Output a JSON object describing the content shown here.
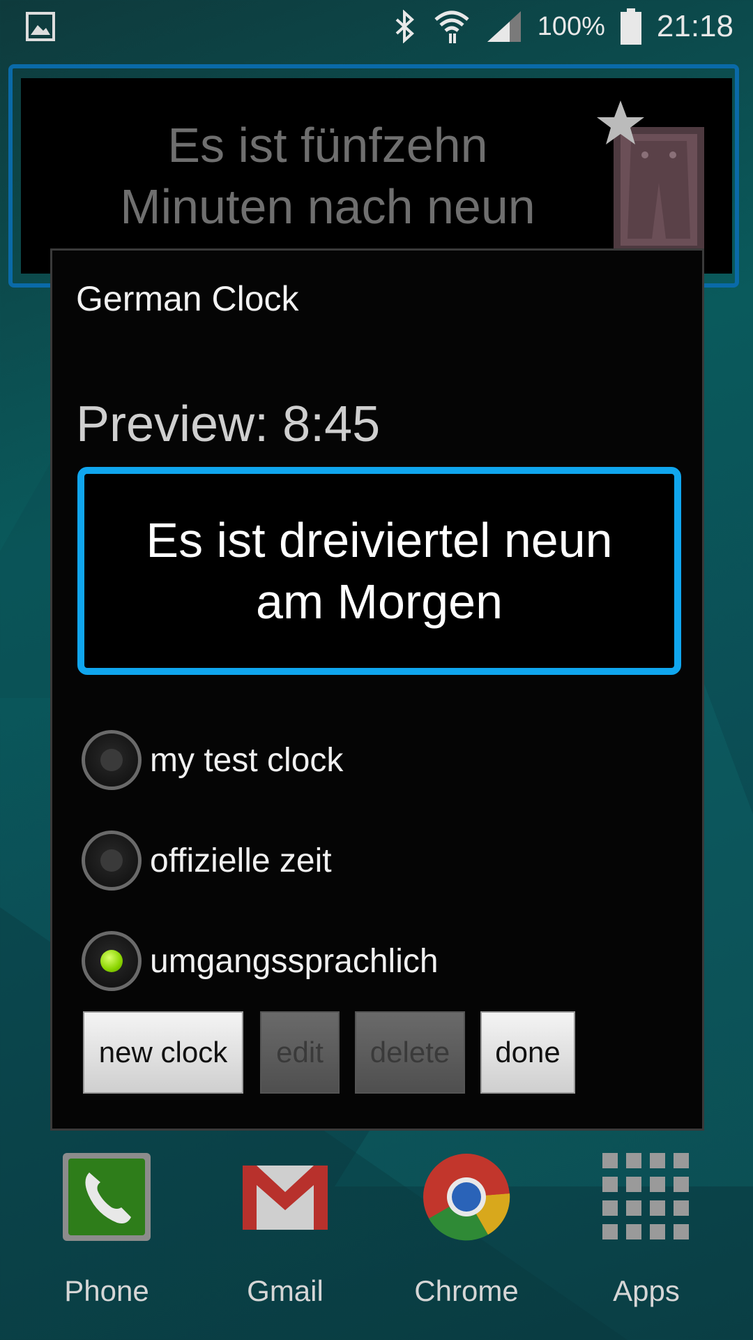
{
  "status_bar": {
    "battery_percent": "100%",
    "time": "21:18"
  },
  "widget": {
    "text": "Es ist fünfzehn Minuten nach neun Uhr"
  },
  "dialog": {
    "title": "German Clock",
    "preview_label": "Preview: 8:45",
    "preview_text": "Es ist dreiviertel neun am Morgen",
    "options": [
      {
        "label": "my test clock",
        "selected": false
      },
      {
        "label": "offizielle zeit",
        "selected": false
      },
      {
        "label": "umgangssprachlich",
        "selected": true
      }
    ],
    "buttons": {
      "new_clock": "new clock",
      "edit": "edit",
      "delete": "delete",
      "done": "done"
    }
  },
  "dock": {
    "phone": "Phone",
    "gmail": "Gmail",
    "chrome": "Chrome",
    "apps": "Apps"
  },
  "colors": {
    "accent": "#10a6ee",
    "radio_selected": "#8ad400"
  }
}
